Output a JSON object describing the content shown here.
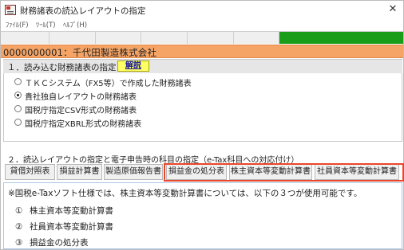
{
  "window": {
    "title": "財務諸表の読込レイアウトの指定",
    "close_glyph": "✕"
  },
  "menu": {
    "items": [
      "ﾌｧｲﾙ(F)",
      "ﾂｰﾙ(T)",
      "ﾍﾙﾌﾟ(H)"
    ]
  },
  "colors": {
    "accent_green": "#1a9e1a",
    "company_bar": "#f5a465",
    "highlight_border": "#e8472a",
    "explain_button": "#ffff66"
  },
  "company": {
    "label": "0000000001：千代田製造株式会社"
  },
  "section1": {
    "title": "１．読み込む財務諸表の指定",
    "explain_label": "解説",
    "options": [
      {
        "label": "ＴＫＣシステム（FX5等）で作成した財務諸表",
        "checked": false
      },
      {
        "label": "貴社独自レイアウトの財務諸表",
        "checked": true
      },
      {
        "label": "国税庁指定CSV形式の財務諸表",
        "checked": false
      },
      {
        "label": "国税庁指定XBRL形式の財務諸表",
        "checked": false
      }
    ]
  },
  "section2": {
    "title": "２．読込レイアウトの指定と電子申告時の科目の指定（e-Tax科目への対応付け）",
    "tabs": [
      "貸借対照表",
      "損益計算書",
      "製造原価報告書",
      "損益金の処分表",
      "株主資本等変動計算書",
      "社員資本等変動計算書"
    ]
  },
  "info": {
    "note": "※国税e-Taxソフト仕様では、株主資本等変動計算書については、以下の３つが使用可能です。",
    "items": [
      {
        "num": "①",
        "label": "株主資本等変動計算書"
      },
      {
        "num": "②",
        "label": "社員資本等変動計算書"
      },
      {
        "num": "③",
        "label": "損益金の処分表"
      }
    ]
  }
}
